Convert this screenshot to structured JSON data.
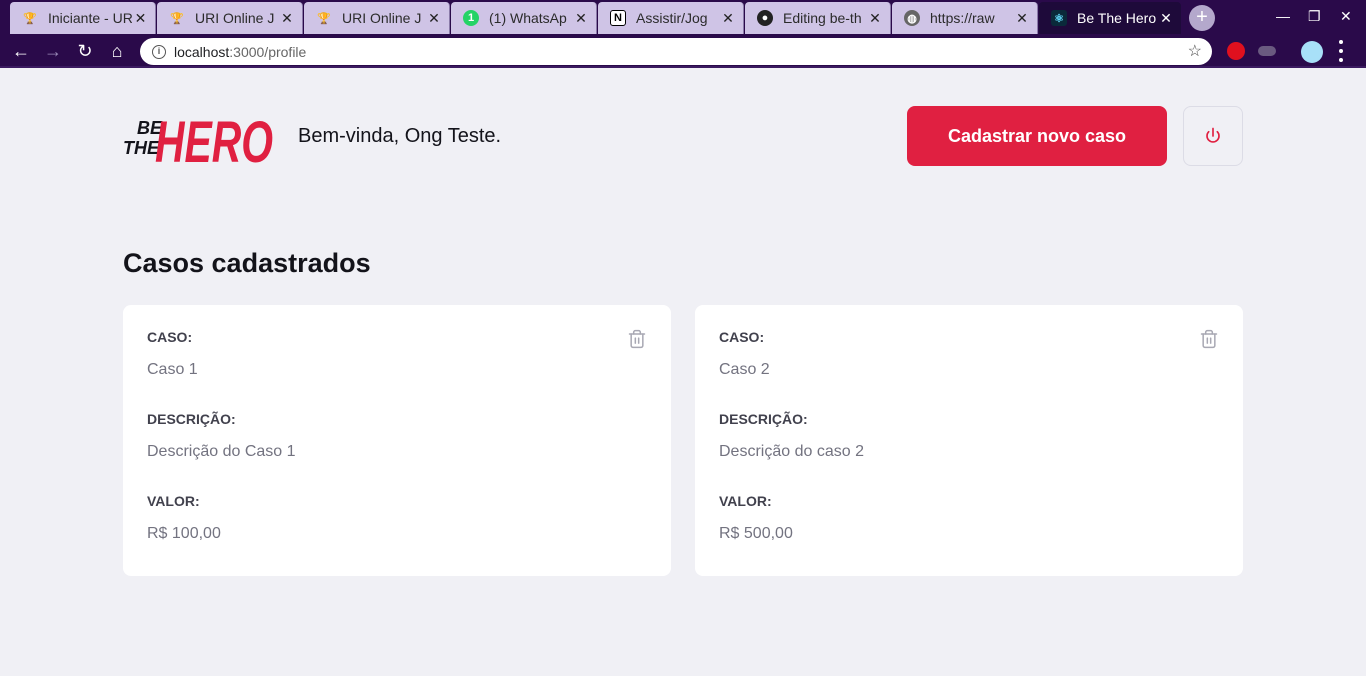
{
  "browser": {
    "tabs": [
      {
        "label": "Iniciante - URI",
        "icon": "trophy-icon",
        "active": false
      },
      {
        "label": "URI Online J",
        "icon": "trophy-icon",
        "active": false
      },
      {
        "label": "URI Online J",
        "icon": "trophy-icon",
        "active": false
      },
      {
        "label": "(1) WhatsAp",
        "icon": "whatsapp-icon",
        "active": false
      },
      {
        "label": "Assistir/Jog",
        "icon": "notion-icon",
        "active": false
      },
      {
        "label": "Editing be-th",
        "icon": "github-icon",
        "active": false
      },
      {
        "label": "https://raw",
        "icon": "globe-icon",
        "active": false
      },
      {
        "label": "Be The Hero",
        "icon": "react-icon",
        "active": true
      }
    ],
    "url_host": "localhost",
    "url_path": ":3000/profile"
  },
  "header": {
    "logo_line1": "BE",
    "logo_line2": "THE",
    "logo_hero": "HERO",
    "welcome": "Bem-vinda, Ong Teste.",
    "new_case_button": "Cadastrar novo caso"
  },
  "main": {
    "title": "Casos cadastrados",
    "cases": [
      {
        "case_label": "CASO:",
        "case": "Caso 1",
        "desc_label": "DESCRIÇÃO:",
        "description": "Descrição do Caso 1",
        "value_label": "VALOR:",
        "value": "R$ 100,00"
      },
      {
        "case_label": "CASO:",
        "case": "Caso 2",
        "desc_label": "DESCRIÇÃO:",
        "description": "Descrição do caso 2",
        "value_label": "VALOR:",
        "value": "R$ 500,00"
      }
    ]
  },
  "colors": {
    "brand": "#e02041",
    "background": "#f0f0f5",
    "chrome": "#2a0a4a"
  }
}
